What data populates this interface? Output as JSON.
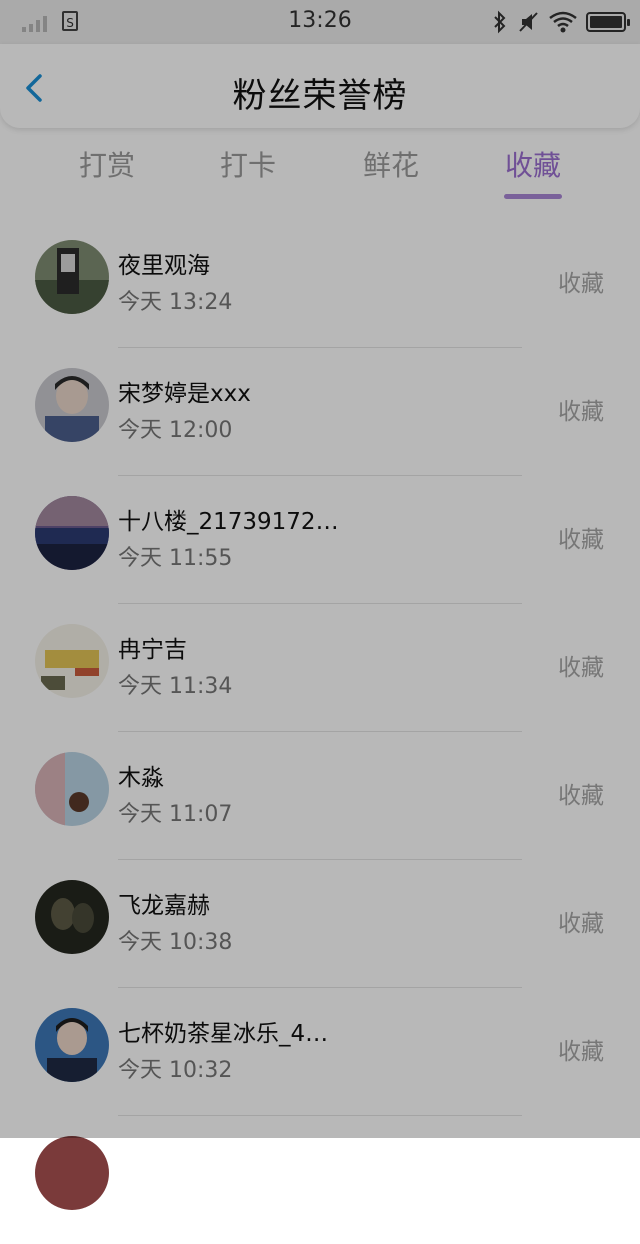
{
  "status_bar": {
    "time": "13:26",
    "sim_label": "S",
    "icons": [
      "signal-icon",
      "sim-icon",
      "bluetooth-icon",
      "mute-icon",
      "wifi-icon",
      "battery-icon"
    ]
  },
  "header": {
    "title": "粉丝荣誉榜",
    "back_icon": "chevron-left-icon"
  },
  "tabs": [
    {
      "label": "打赏",
      "active": false
    },
    {
      "label": "打卡",
      "active": false
    },
    {
      "label": "鲜花",
      "active": false
    },
    {
      "label": "收藏",
      "active": true
    }
  ],
  "colors": {
    "accent": "#9b6fd0",
    "tab_inactive": "#9a9a9a",
    "back_icon": "#1a8fd6"
  },
  "list": [
    {
      "name": "夜里观海",
      "time": "今天 13:24",
      "action": "收藏"
    },
    {
      "name": "宋梦婷是xxx",
      "time": "今天 12:00",
      "action": "收藏"
    },
    {
      "name": "十八楼_21739172…",
      "time": "今天 11:55",
      "action": "收藏"
    },
    {
      "name": "冉宁吉",
      "time": "今天 11:34",
      "action": "收藏"
    },
    {
      "name": "木淼",
      "time": "今天 11:07",
      "action": "收藏"
    },
    {
      "name": "飞龙嘉赫",
      "time": "今天 10:38",
      "action": "收藏"
    },
    {
      "name": "七杯奶茶星冰乐_4…",
      "time": "今天 10:32",
      "action": "收藏"
    }
  ]
}
